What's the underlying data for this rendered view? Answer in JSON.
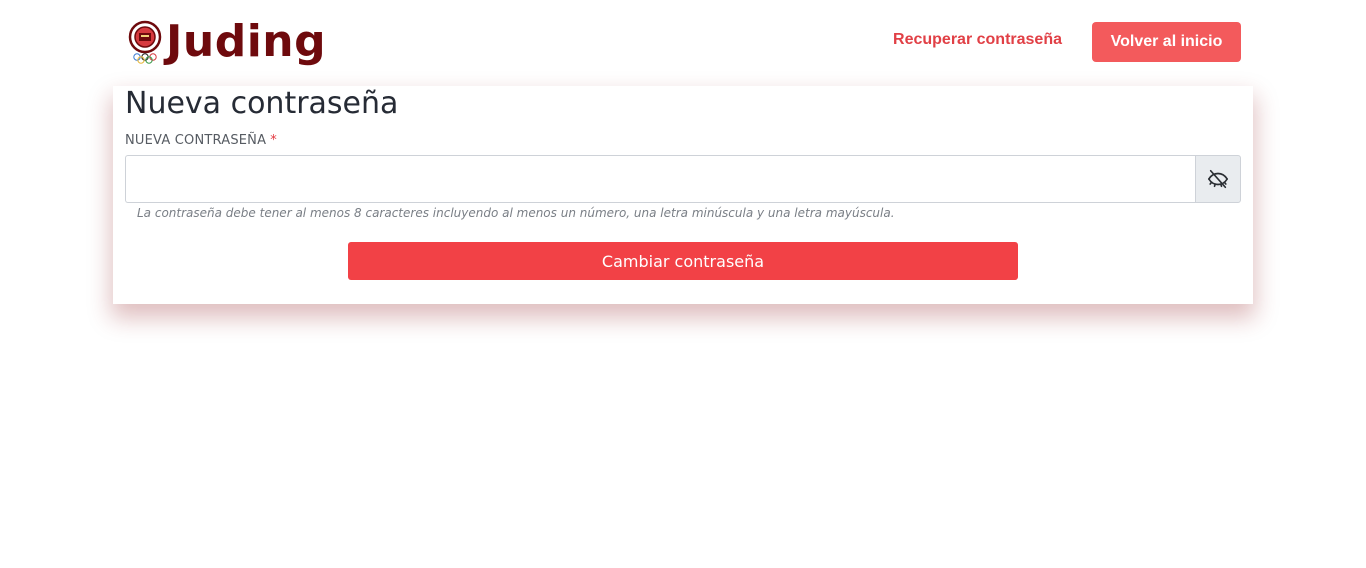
{
  "brand": {
    "name": "Juding",
    "emblem_icon": "judo-federation-emblem-icon",
    "color": "#6e0a0d"
  },
  "nav": {
    "recover_link": "Recuperar contraseña",
    "back_button": "Volver al inicio"
  },
  "form": {
    "title": "Nueva contraseña",
    "password_label": "NUEVA CONTRASEÑA",
    "required_mark": "*",
    "password_value": "",
    "toggle_icon": "eye-slash-icon",
    "hint": "La contraseña debe tener al menos 8 caracteres incluyendo al menos un número, una letra minúscula y una letra mayúscula.",
    "submit_label": "Cambiar contraseña"
  },
  "colors": {
    "accent": "#f24146",
    "nav_button": "#f35a5c",
    "link": "#e14046"
  }
}
